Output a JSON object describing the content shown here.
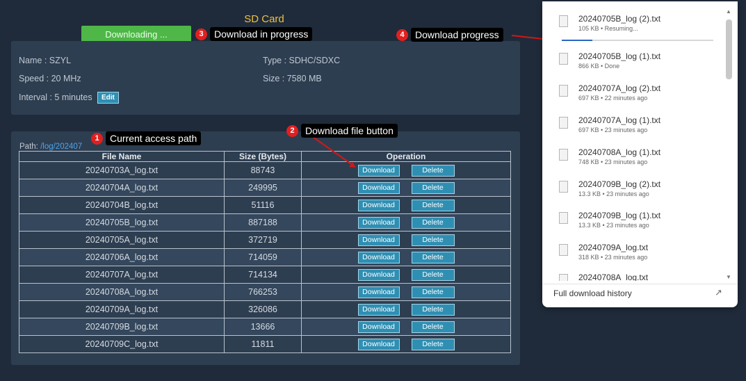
{
  "header": {
    "title": "SD Card",
    "download_status": "Downloading ..."
  },
  "info": {
    "name": "Name : SZYL",
    "speed": "Speed : 20 MHz",
    "interval": "Interval : 5 minutes",
    "edit": "Edit",
    "type": "Type : SDHC/SDXC",
    "size": "Size : 7580 MB"
  },
  "files": {
    "path_label": "Path:",
    "path_value": "/log/202407",
    "columns": [
      "File Name",
      "Size (Bytes)",
      "Operation"
    ],
    "download_label": "Download",
    "delete_label": "Delete",
    "rows": [
      {
        "name": "20240703A_log.txt",
        "size": "88743"
      },
      {
        "name": "20240704A_log.txt",
        "size": "249995"
      },
      {
        "name": "20240704B_log.txt",
        "size": "51116"
      },
      {
        "name": "20240705B_log.txt",
        "size": "887188"
      },
      {
        "name": "20240705A_log.txt",
        "size": "372719"
      },
      {
        "name": "20240706A_log.txt",
        "size": "714059"
      },
      {
        "name": "20240707A_log.txt",
        "size": "714134"
      },
      {
        "name": "20240708A_log.txt",
        "size": "766253"
      },
      {
        "name": "20240709A_log.txt",
        "size": "326086"
      },
      {
        "name": "20240709B_log.txt",
        "size": "13666"
      },
      {
        "name": "20240709C_log.txt",
        "size": "11811"
      }
    ]
  },
  "annotations": [
    {
      "num": "1",
      "label": "Current access path"
    },
    {
      "num": "2",
      "label": "Download file button"
    },
    {
      "num": "3",
      "label": "Download in progress"
    },
    {
      "num": "4",
      "label": "Download progress"
    }
  ],
  "downloads": {
    "items": [
      {
        "name": "20240705B_log (2).txt",
        "meta": "105 KB • Resuming...",
        "progress": 0.2
      },
      {
        "name": "20240705B_log (1).txt",
        "meta": "866 KB • Done"
      },
      {
        "name": "20240707A_log (2).txt",
        "meta": "697 KB • 22 minutes ago"
      },
      {
        "name": "20240707A_log (1).txt",
        "meta": "697 KB • 23 minutes ago"
      },
      {
        "name": "20240708A_log (1).txt",
        "meta": "748 KB • 23 minutes ago"
      },
      {
        "name": "20240709B_log (2).txt",
        "meta": "13.3 KB • 23 minutes ago"
      },
      {
        "name": "20240709B_log (1).txt",
        "meta": "13.3 KB • 23 minutes ago"
      },
      {
        "name": "20240709A_log.txt",
        "meta": "318 KB • 23 minutes ago"
      },
      {
        "name": "20240708A_log.txt",
        "meta": ""
      }
    ],
    "history_label": "Full download history",
    "external_icon": "external-link-icon"
  },
  "colors": {
    "background": "#1f2b3a",
    "panel": "#2e3e51",
    "title": "#f0c040",
    "download_status_bg": "#4fb748",
    "button": "#2f8fb3",
    "annotation_badge": "#e02020",
    "progress": "#2a67c2"
  }
}
